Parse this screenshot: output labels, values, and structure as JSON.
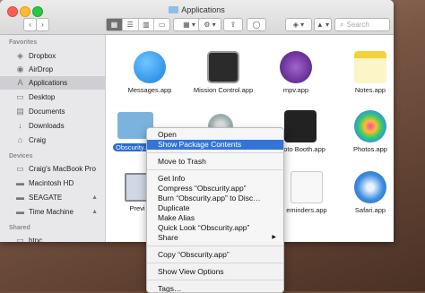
{
  "window": {
    "title": "Applications"
  },
  "toolbar": {
    "back": "‹",
    "forward": "›",
    "views": [
      "▦",
      "☰",
      "▥",
      "▭"
    ],
    "arrange": "▦ ▾",
    "action": "⚙ ▾",
    "share": "⇪",
    "tag": "◯",
    "dropbox": "◈ ▾",
    "eject": "▲ ▾",
    "search_placeholder": "Search"
  },
  "sidebar": {
    "favorites_header": "Favorites",
    "favorites": [
      {
        "label": "Dropbox",
        "icon": "dropbox-icon",
        "glyph": "◈"
      },
      {
        "label": "AirDrop",
        "icon": "airdrop-icon",
        "glyph": "◉"
      },
      {
        "label": "Applications",
        "icon": "applications-icon",
        "glyph": "A"
      },
      {
        "label": "Desktop",
        "icon": "desktop-icon",
        "glyph": "▭"
      },
      {
        "label": "Documents",
        "icon": "documents-icon",
        "glyph": "▤"
      },
      {
        "label": "Downloads",
        "icon": "downloads-icon",
        "glyph": "↓"
      },
      {
        "label": "Craig",
        "icon": "home-icon",
        "glyph": "⌂"
      }
    ],
    "devices_header": "Devices",
    "devices": [
      {
        "label": "Craig's MacBook Pro",
        "icon": "laptop-icon",
        "glyph": "▭"
      },
      {
        "label": "Macintosh HD",
        "icon": "drive-icon",
        "glyph": "▬"
      },
      {
        "label": "SEAGATE",
        "icon": "drive-icon",
        "glyph": "▬",
        "eject": "▲"
      },
      {
        "label": "Time Machine",
        "icon": "drive-icon",
        "glyph": "▬",
        "eject": "▲"
      }
    ],
    "shared_header": "Shared",
    "shared": [
      {
        "label": "htpc",
        "icon": "server-icon",
        "glyph": "▭"
      }
    ]
  },
  "apps": {
    "messages": "Messages.app",
    "mission_control": "Mission Control.app",
    "mpv": "mpv.app",
    "notes": "Notes.app",
    "obscurity": "Obscurity.app",
    "photo_booth": "Photo Booth.app",
    "photos": "Photos.app",
    "preview": "Previ",
    "reminders": "eminders.app",
    "safari": "Safari.app"
  },
  "context_menu": {
    "open": "Open",
    "show_package": "Show Package Contents",
    "trash": "Move to Trash",
    "get_info": "Get Info",
    "compress": "Compress “Obscurity.app”",
    "burn": "Burn “Obscurity.app” to Disc…",
    "duplicate": "Duplicate",
    "alias": "Make Alias",
    "quick_look": "Quick Look “Obscurity.app”",
    "share": "Share",
    "share_arrow": "▶",
    "copy": "Copy “Obscurity.app”",
    "view_options": "Show View Options",
    "tags": "Tags…"
  }
}
